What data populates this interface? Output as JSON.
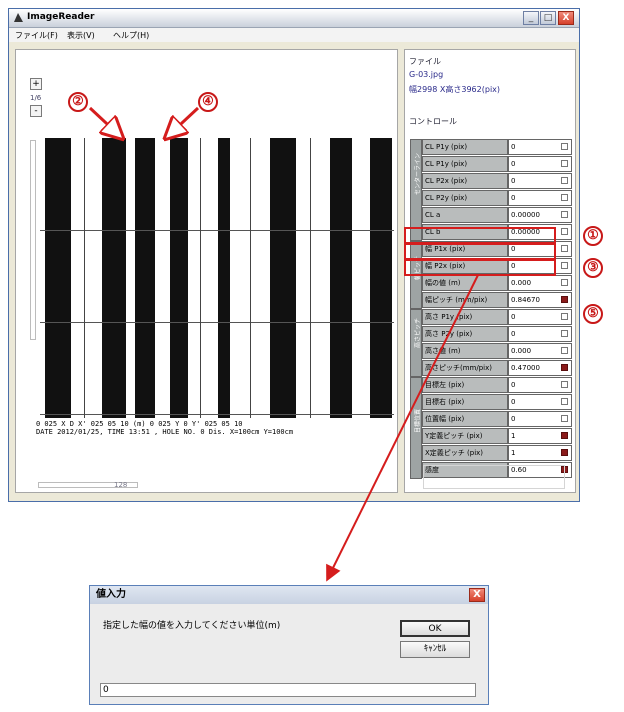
{
  "window": {
    "title": "ImageReader",
    "buttons": {
      "minimize": "_",
      "maximize": "□",
      "close": "X"
    },
    "menu": [
      "ファイル(F)",
      "表示(V)",
      "ヘルプ(H)"
    ]
  },
  "image_pane": {
    "zoom_in": "+",
    "zoom_level": "1/6",
    "zoom_out": "-",
    "axis_line1": "0   025   X   D   X'   025   05   10 (m) 0   025   Y   0   Y'   025   05   10",
    "axis_line2": "DATE 2012/01/25, TIME 13:51 , HOLE NO.   0   Dis. X=100cm Y=100cm",
    "hscroll_value": "128"
  },
  "side": {
    "file_header": "ファイル",
    "file_name": "G-03.jpg",
    "file_size": "幅2998 X高さ3962(pix)",
    "control_header": "コントロール",
    "groups": [
      "センターライン",
      "幅ピッチ",
      "高さピッチ",
      "目標位置"
    ],
    "rows": [
      {
        "name": "CL P1y (pix)",
        "value": "0",
        "check": "empty"
      },
      {
        "name": "CL P1y (pix)",
        "value": "0",
        "check": "empty"
      },
      {
        "name": "CL P2x (pix)",
        "value": "0",
        "check": "empty"
      },
      {
        "name": "CL P2y (pix)",
        "value": "0",
        "check": "empty"
      },
      {
        "name": "CL a",
        "value": "0.00000",
        "check": "empty"
      },
      {
        "name": "CL b",
        "value": "0.00000",
        "check": "empty"
      },
      {
        "name": "幅 P1x (pix)",
        "value": "0",
        "check": "empty"
      },
      {
        "name": "幅 P2x (pix)",
        "value": "0",
        "check": "empty"
      },
      {
        "name": "幅の値 (m)",
        "value": "0.000",
        "check": "empty"
      },
      {
        "name": "幅ピッチ (mm/pix)",
        "value": "0.84670",
        "check": "red"
      },
      {
        "name": "高さ P1y (pix)",
        "value": "0",
        "check": "empty"
      },
      {
        "name": "高さ P2y (pix)",
        "value": "0",
        "check": "empty"
      },
      {
        "name": "高さ値 (m)",
        "value": "0.000",
        "check": "empty"
      },
      {
        "name": "高さピッチ(mm/pix)",
        "value": "0.47000",
        "check": "red"
      },
      {
        "name": "目標左 (pix)",
        "value": "0",
        "check": "empty"
      },
      {
        "name": "目標右 (pix)",
        "value": "0",
        "check": "empty"
      },
      {
        "name": "位置幅 (pix)",
        "value": "0",
        "check": "empty"
      },
      {
        "name": "Y定義ピッチ (pix)",
        "value": "1",
        "check": "red"
      },
      {
        "name": "X定義ピッチ (pix)",
        "value": "1",
        "check": "red"
      },
      {
        "name": "感度",
        "value": "0.60",
        "check": "red"
      }
    ]
  },
  "markers": [
    "①",
    "②",
    "③",
    "④",
    "⑤"
  ],
  "annotation_color": "#d51d1d",
  "dialog": {
    "title": "値入力",
    "close": "X",
    "prompt": "指定した幅の値を入力してください単位(m)",
    "ok": "OK",
    "cancel": "ｷｬﾝｾﾙ",
    "input_value": "0"
  }
}
